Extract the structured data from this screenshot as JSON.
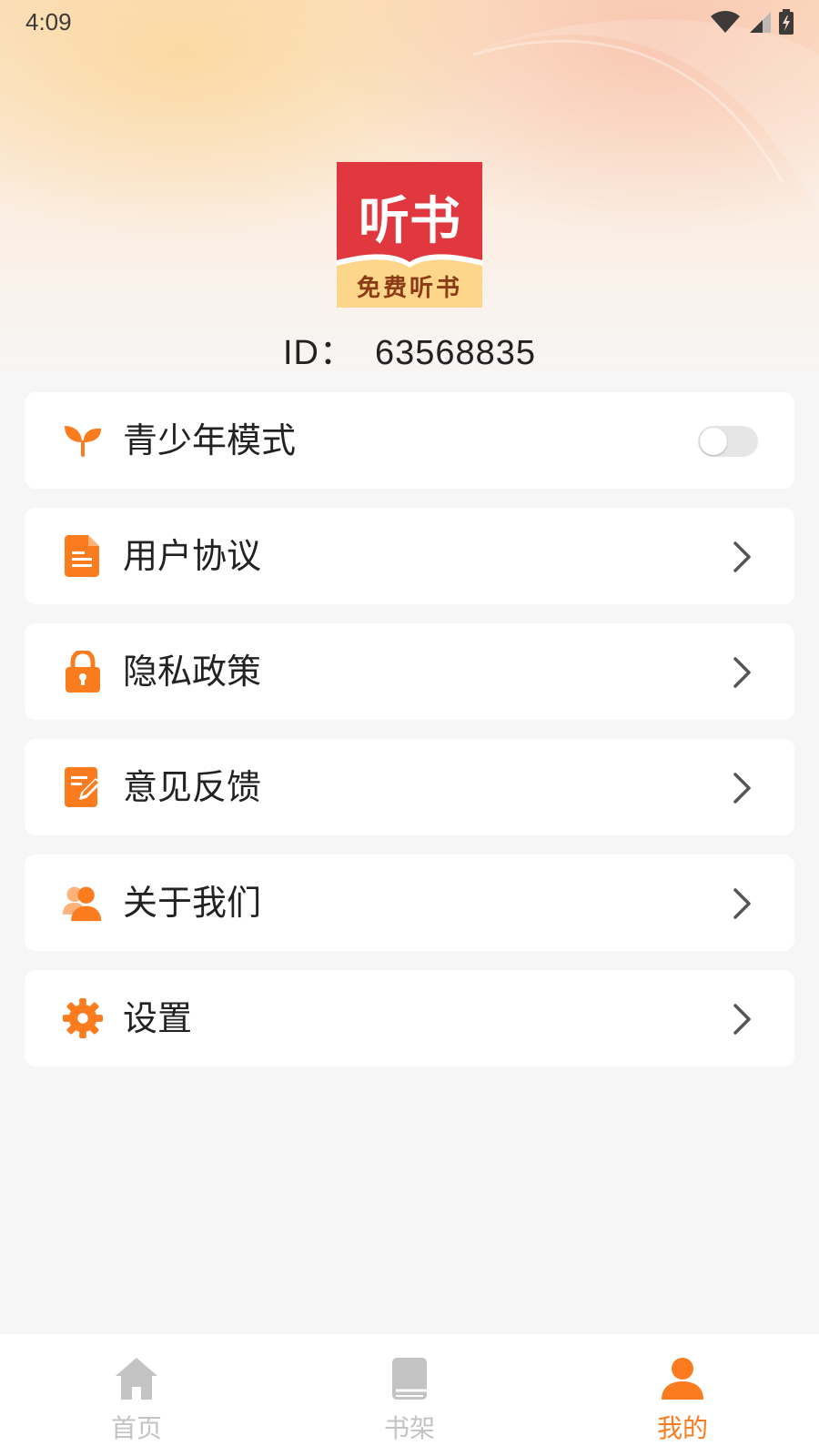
{
  "status_bar": {
    "time": "4:09",
    "icons": [
      "wifi-icon",
      "signal-icon",
      "battery-icon"
    ]
  },
  "logo": {
    "main_text": "听书",
    "sub_text": "免费听书",
    "colors": {
      "red": "#e1373e",
      "banner": "#fdd58b",
      "banner_text": "#8b3b16"
    }
  },
  "profile": {
    "id_label": "ID：",
    "id_value": "63568835"
  },
  "menu": {
    "items": [
      {
        "label": "青少年模式",
        "icon": "sprout-icon",
        "control": "toggle",
        "toggle_on": false
      },
      {
        "label": "用户协议",
        "icon": "document-icon",
        "control": "chevron"
      },
      {
        "label": "隐私政策",
        "icon": "lock-icon",
        "control": "chevron"
      },
      {
        "label": "意见反馈",
        "icon": "feedback-edit-icon",
        "control": "chevron"
      },
      {
        "label": "关于我们",
        "icon": "users-icon",
        "control": "chevron"
      },
      {
        "label": "设置",
        "icon": "gear-icon",
        "control": "chevron"
      }
    ]
  },
  "tabbar": {
    "tabs": [
      {
        "label": "首页",
        "icon": "home-icon",
        "active": false
      },
      {
        "label": "书架",
        "icon": "bookshelf-icon",
        "active": false
      },
      {
        "label": "我的",
        "icon": "person-icon",
        "active": true
      }
    ]
  },
  "colors": {
    "accent": "#fb7c1e",
    "inactive": "#c3c3c3",
    "text": "#222222",
    "card": "#ffffff",
    "background": "#f7f6f6"
  }
}
